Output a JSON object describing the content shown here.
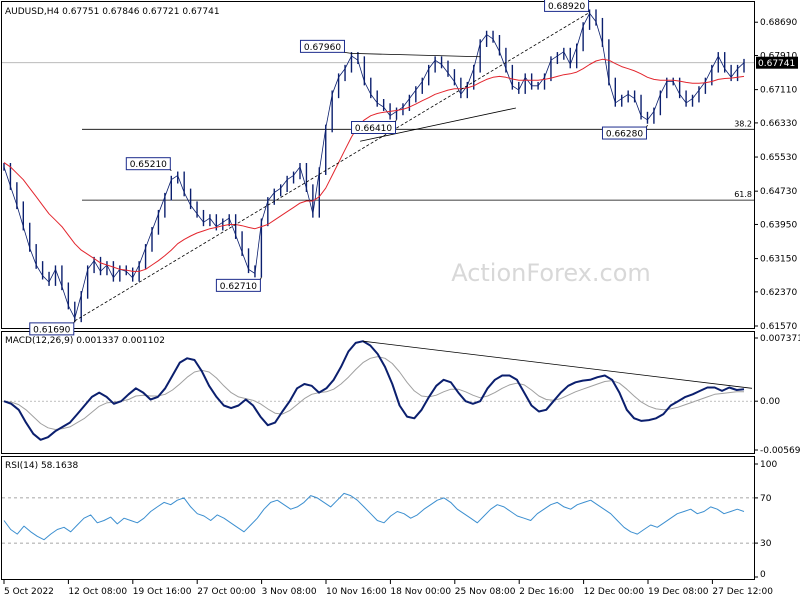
{
  "chart_data": {
    "type": "line",
    "symbol_header": "AUDUSD,H4  0.67751 0.67846 0.67721 0.67741",
    "watermark": "ActionForex.com",
    "colors": {
      "price": "#0b1f6e",
      "ma": "#e3262e",
      "trend": "#000000",
      "fib": "#000000",
      "macd": "#0b1f6e",
      "signal": "#a0a0a0",
      "rsi": "#3c8fd0",
      "level": "#888888",
      "label_border": "#1c2c8c"
    },
    "x_ticks": [
      "5 Oct 2022",
      "12 Oct 08:00",
      "19 Oct 16:00",
      "27 Oct 00:00",
      "3 Nov 08:00",
      "10 Nov 16:00",
      "18 Nov 00:00",
      "25 Nov 08:00",
      "2 Dec 16:00",
      "12 Dec 00:00",
      "19 Dec 08:00",
      "27 Dec 12:00"
    ],
    "price_panel": {
      "y_ticks": [
        "0.68690",
        "0.67910",
        "0.67110",
        "0.66330",
        "0.65530",
        "0.64730",
        "0.63950",
        "0.63150",
        "0.62370",
        "0.61570"
      ],
      "ylim": [
        0.6157,
        0.6907
      ],
      "current_label": "0.67741",
      "current_value": 0.67741,
      "fib_levels": [
        {
          "label": "38.2",
          "value": 0.6618
        },
        {
          "label": "61.8",
          "value": 0.6452
        }
      ],
      "annotations": [
        {
          "text": "0.61690",
          "value": 0.6169
        },
        {
          "text": "0.65210",
          "value": 0.6521
        },
        {
          "text": "0.62710",
          "value": 0.6271
        },
        {
          "text": "0.67960",
          "value": 0.6796
        },
        {
          "text": "0.66410",
          "value": 0.6641
        },
        {
          "text": "0.68920",
          "value": 0.6892
        },
        {
          "text": "0.66280",
          "value": 0.6628
        }
      ],
      "series": [
        {
          "name": "price",
          "values": [
            0.653,
            0.6485,
            0.644,
            0.639,
            0.634,
            0.63,
            0.6275,
            0.626,
            0.629,
            0.625,
            0.6205,
            0.6175,
            0.623,
            0.629,
            0.631,
            0.6285,
            0.63,
            0.627,
            0.629,
            0.6285,
            0.627,
            0.63,
            0.634,
            0.638,
            0.642,
            0.646,
            0.65,
            0.651,
            0.647,
            0.644,
            0.642,
            0.64,
            0.641,
            0.639,
            0.64,
            0.641,
            0.637,
            0.633,
            0.629,
            0.628,
            0.64,
            0.645,
            0.647,
            0.648,
            0.65,
            0.651,
            0.653,
            0.648,
            0.642,
            0.652,
            0.662,
            0.67,
            0.674,
            0.676,
            0.679,
            0.678,
            0.673,
            0.67,
            0.668,
            0.667,
            0.665,
            0.666,
            0.667,
            0.669,
            0.671,
            0.673,
            0.676,
            0.678,
            0.677,
            0.675,
            0.673,
            0.67,
            0.672,
            0.676,
            0.682,
            0.684,
            0.683,
            0.68,
            0.676,
            0.672,
            0.671,
            0.674,
            0.672,
            0.672,
            0.674,
            0.678,
            0.679,
            0.68,
            0.677,
            0.681,
            0.686,
            0.689,
            0.687,
            0.682,
            0.673,
            0.668,
            0.669,
            0.67,
            0.669,
            0.665,
            0.664,
            0.666,
            0.67,
            0.673,
            0.673,
            0.67,
            0.668,
            0.669,
            0.671,
            0.673,
            0.676,
            0.679,
            0.676,
            0.674,
            0.676,
            0.6774
          ]
        },
        {
          "name": "ma",
          "values": [
            0.654,
            0.653,
            0.6515,
            0.65,
            0.648,
            0.646,
            0.644,
            0.642,
            0.6405,
            0.639,
            0.637,
            0.635,
            0.6335,
            0.6325,
            0.6315,
            0.6305,
            0.63,
            0.6295,
            0.629,
            0.6288,
            0.6285,
            0.6285,
            0.629,
            0.63,
            0.631,
            0.6322,
            0.6335,
            0.635,
            0.636,
            0.6368,
            0.6375,
            0.638,
            0.6385,
            0.6388,
            0.6392,
            0.6395,
            0.6395,
            0.6392,
            0.6388,
            0.6385,
            0.639,
            0.6395,
            0.6405,
            0.6415,
            0.6425,
            0.6435,
            0.6445,
            0.645,
            0.645,
            0.646,
            0.648,
            0.651,
            0.654,
            0.657,
            0.66,
            0.6625,
            0.664,
            0.665,
            0.6655,
            0.6658,
            0.666,
            0.6662,
            0.6665,
            0.667,
            0.6677,
            0.6685,
            0.6692,
            0.67,
            0.6705,
            0.671,
            0.6713,
            0.6713,
            0.6715,
            0.672,
            0.6728,
            0.6735,
            0.674,
            0.6742,
            0.674,
            0.6736,
            0.6733,
            0.6733,
            0.6733,
            0.6733,
            0.6735,
            0.6738,
            0.6742,
            0.6746,
            0.6748,
            0.6752,
            0.676,
            0.677,
            0.6778,
            0.6782,
            0.678,
            0.6772,
            0.6765,
            0.676,
            0.6755,
            0.6748,
            0.674,
            0.6735,
            0.6733,
            0.6733,
            0.6733,
            0.6731,
            0.6728,
            0.6726,
            0.6726,
            0.6727,
            0.673,
            0.6735,
            0.6737,
            0.6738,
            0.674,
            0.6742
          ]
        }
      ]
    },
    "macd_panel": {
      "label": "MACD(12,26,9) 0.001337 0.001102",
      "y_ticks": [
        "0.007371",
        "0.00",
        "-0.005693"
      ],
      "ylim": [
        -0.005693,
        0.007371
      ],
      "series": [
        {
          "name": "macd",
          "values": [
            0.0,
            -0.0003,
            -0.001,
            -0.0025,
            -0.0038,
            -0.0045,
            -0.0042,
            -0.0035,
            -0.003,
            -0.0025,
            -0.0015,
            -0.0005,
            0.0005,
            0.001,
            0.0005,
            -0.0003,
            0.0,
            0.0008,
            0.0015,
            0.001,
            0.0002,
            0.0005,
            0.0015,
            0.003,
            0.0045,
            0.005,
            0.0048,
            0.0035,
            0.0018,
            0.0005,
            -0.0005,
            -0.0008,
            -0.0005,
            0.0002,
            -0.0005,
            -0.0018,
            -0.0028,
            -0.0025,
            -0.0012,
            0.0,
            0.0015,
            0.002,
            0.0018,
            0.001,
            0.0015,
            0.0025,
            0.004,
            0.0058,
            0.0068,
            0.007,
            0.0065,
            0.0055,
            0.004,
            0.002,
            -0.0005,
            -0.0018,
            -0.002,
            -0.001,
            0.0005,
            0.0018,
            0.0025,
            0.0022,
            0.001,
            0.0,
            -0.0003,
            0.0,
            0.0015,
            0.0025,
            0.003,
            0.003,
            0.0025,
            0.001,
            -0.0005,
            -0.0012,
            -0.001,
            0.0,
            0.001,
            0.0018,
            0.0022,
            0.0024,
            0.0025,
            0.0028,
            0.003,
            0.0025,
            0.001,
            -0.001,
            -0.002,
            -0.0023,
            -0.0022,
            -0.002,
            -0.0015,
            -0.0005,
            0.0,
            0.0005,
            0.0008,
            0.0012,
            0.0016,
            0.0016,
            0.0012,
            0.0016,
            0.0013,
            0.0014
          ]
        },
        {
          "name": "signal",
          "values": [
            0.0,
            -0.0001,
            -0.0004,
            -0.001,
            -0.0018,
            -0.0026,
            -0.0031,
            -0.0033,
            -0.0032,
            -0.003,
            -0.0025,
            -0.002,
            -0.0013,
            -0.0006,
            -0.0002,
            -0.0001,
            0.0,
            0.0002,
            0.0006,
            0.0007,
            0.0006,
            0.0006,
            0.0008,
            0.0013,
            0.002,
            0.0028,
            0.0034,
            0.0036,
            0.0034,
            0.0027,
            0.0018,
            0.001,
            0.0005,
            0.0003,
            0.0001,
            -0.0003,
            -0.0009,
            -0.0014,
            -0.0015,
            -0.0011,
            -0.0004,
            0.0003,
            0.0008,
            0.001,
            0.0011,
            0.0014,
            0.002,
            0.0028,
            0.0037,
            0.0045,
            0.005,
            0.0052,
            0.005,
            0.0044,
            0.0034,
            0.0022,
            0.0012,
            0.0006,
            0.0005,
            0.0007,
            0.0011,
            0.0014,
            0.0014,
            0.0011,
            0.0007,
            0.0004,
            0.0006,
            0.001,
            0.0015,
            0.0019,
            0.0021,
            0.0019,
            0.0013,
            0.0006,
            0.0002,
            0.0001,
            0.0003,
            0.0007,
            0.0011,
            0.0014,
            0.0017,
            0.002,
            0.0023,
            0.0024,
            0.0021,
            0.0014,
            0.0006,
            -0.0001,
            -0.0006,
            -0.0009,
            -0.001,
            -0.0009,
            -0.0007,
            -0.0004,
            -0.0001,
            0.0002,
            0.0005,
            0.0008,
            0.0009,
            0.001,
            0.0011,
            0.0011
          ]
        }
      ]
    },
    "rsi_panel": {
      "label": "RSI(14) 58.1638",
      "y_ticks": [
        "100",
        "70",
        "30",
        "0"
      ],
      "ylim": [
        0,
        100
      ],
      "levels": [
        70,
        30
      ],
      "series": [
        {
          "name": "rsi",
          "values": [
            50,
            42,
            38,
            45,
            40,
            36,
            33,
            38,
            42,
            44,
            40,
            46,
            52,
            55,
            48,
            50,
            53,
            47,
            52,
            50,
            48,
            52,
            58,
            62,
            66,
            64,
            68,
            70,
            62,
            56,
            54,
            50,
            55,
            52,
            48,
            44,
            40,
            46,
            52,
            60,
            66,
            68,
            64,
            60,
            62,
            66,
            72,
            70,
            66,
            62,
            68,
            74,
            72,
            68,
            62,
            56,
            50,
            48,
            54,
            58,
            56,
            52,
            55,
            60,
            64,
            68,
            70,
            66,
            60,
            56,
            52,
            48,
            54,
            60,
            64,
            62,
            58,
            54,
            52,
            50,
            56,
            60,
            64,
            66,
            62,
            60,
            64,
            66,
            68,
            64,
            60,
            56,
            50,
            44,
            40,
            38,
            42,
            46,
            44,
            48,
            52,
            56,
            58,
            60,
            56,
            58,
            62,
            60,
            56,
            58,
            60,
            58
          ]
        }
      ]
    }
  }
}
